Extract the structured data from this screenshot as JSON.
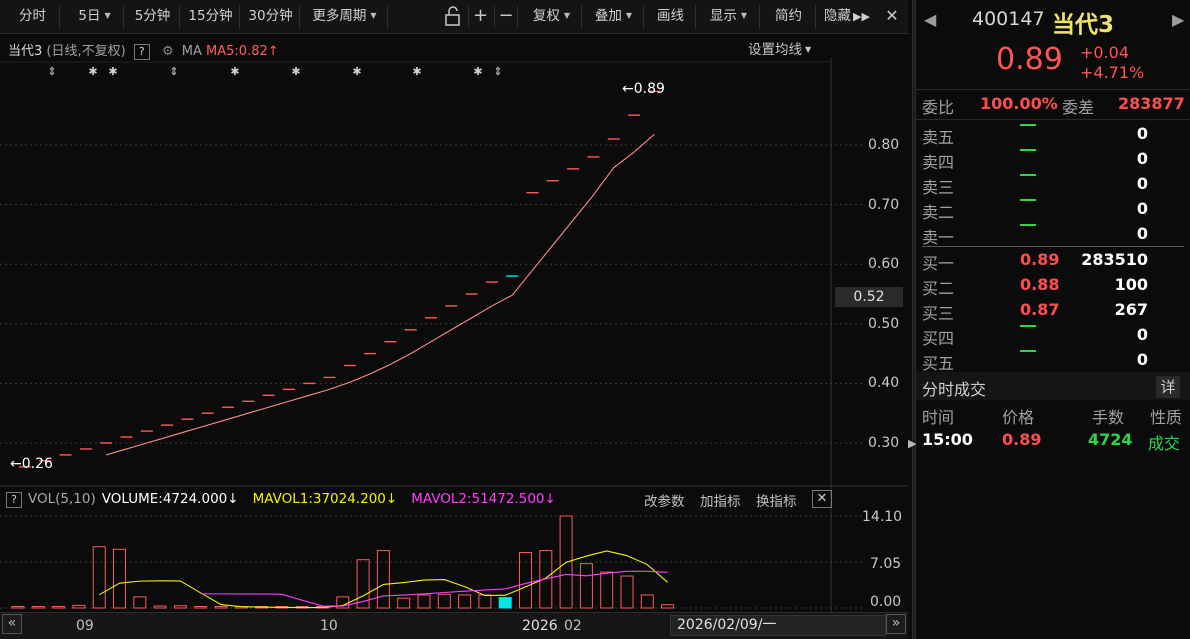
{
  "toolbar": {
    "buttons": [
      "分时",
      "5日",
      "5分钟",
      "15分钟",
      "30分钟",
      "更多周期",
      "复权",
      "叠加",
      "画线",
      "显示",
      "简约",
      "隐藏"
    ]
  },
  "chart": {
    "stock_name": "当代3",
    "mode": "(日线,不复权)",
    "help": "?",
    "ma_label": "MA",
    "ma5": "MA5:0.82",
    "ma5_arrow": "↑",
    "set_ma": "设置均线",
    "high_marker": "0.89",
    "low_marker": "0.26",
    "current_price_tag": "0.52",
    "y_ticks": [
      "0.80",
      "0.70",
      "0.60",
      "0.50",
      "0.40",
      "0.30"
    ],
    "x_labels": [
      "09",
      "10",
      "2026",
      "02"
    ],
    "date_tag": "2026/02/09/一",
    "vol_label": "VOL(5,10)",
    "volume": "VOLUME:4724.000",
    "mavol1": "MAVOL1:37024.200",
    "mavol2": "MAVOL2:51472.500",
    "vol_tools": [
      "改参数",
      "加指标",
      "换指标"
    ],
    "vol_y_ticks": [
      "14.10",
      "7.05",
      "0.00"
    ]
  },
  "chart_data": {
    "type": "candlestick",
    "closes": [
      0.26,
      0.27,
      0.28,
      0.29,
      0.3,
      0.31,
      0.32,
      0.33,
      0.34,
      0.35,
      0.36,
      0.37,
      0.38,
      0.39,
      0.4,
      0.41,
      0.43,
      0.45,
      0.47,
      0.49,
      0.51,
      0.53,
      0.55,
      0.57,
      0.58,
      0.72,
      0.74,
      0.76,
      0.78,
      0.81,
      0.85,
      0.89
    ],
    "volumes_10k": [
      0.1,
      0.1,
      0.1,
      0.4,
      9.4,
      9.0,
      1.7,
      0.3,
      0.35,
      0.2,
      0.1,
      0.05,
      0.05,
      0.05,
      0.05,
      0.1,
      1.7,
      7.4,
      8.8,
      1.5,
      2.0,
      2.1,
      2.0,
      2.0,
      1.6,
      8.5,
      8.8,
      14.1,
      6.8,
      5.5,
      4.9,
      2.0,
      0.5
    ],
    "ylim": [
      0.25,
      0.92
    ],
    "vol_ylim": [
      0,
      14.1
    ]
  },
  "quote": {
    "code": "400147",
    "name": "当代3",
    "price": "0.89",
    "change": "+0.04",
    "change_pct": "+4.71%",
    "weibi_label": "委比",
    "weibi": "100.00%",
    "weicha_label": "委差",
    "weicha": "283877",
    "sells": [
      {
        "label": "卖五",
        "price": "—",
        "vol": "0"
      },
      {
        "label": "卖四",
        "price": "—",
        "vol": "0"
      },
      {
        "label": "卖三",
        "price": "—",
        "vol": "0"
      },
      {
        "label": "卖二",
        "price": "—",
        "vol": "0"
      },
      {
        "label": "卖一",
        "price": "—",
        "vol": "0"
      }
    ],
    "buys": [
      {
        "label": "买一",
        "price": "0.89",
        "vol": "283510"
      },
      {
        "label": "买二",
        "price": "0.88",
        "vol": "100"
      },
      {
        "label": "买三",
        "price": "0.87",
        "vol": "267"
      },
      {
        "label": "买四",
        "price": "—",
        "vol": "0"
      },
      {
        "label": "买五",
        "price": "—",
        "vol": "0"
      }
    ],
    "ticks_title": "分时成交",
    "detail": "详",
    "tick_headers": [
      "时间",
      "价格",
      "手数",
      "性质"
    ],
    "tick": {
      "time": "15:00",
      "price": "0.89",
      "vol": "4724",
      "type": "成交"
    }
  }
}
